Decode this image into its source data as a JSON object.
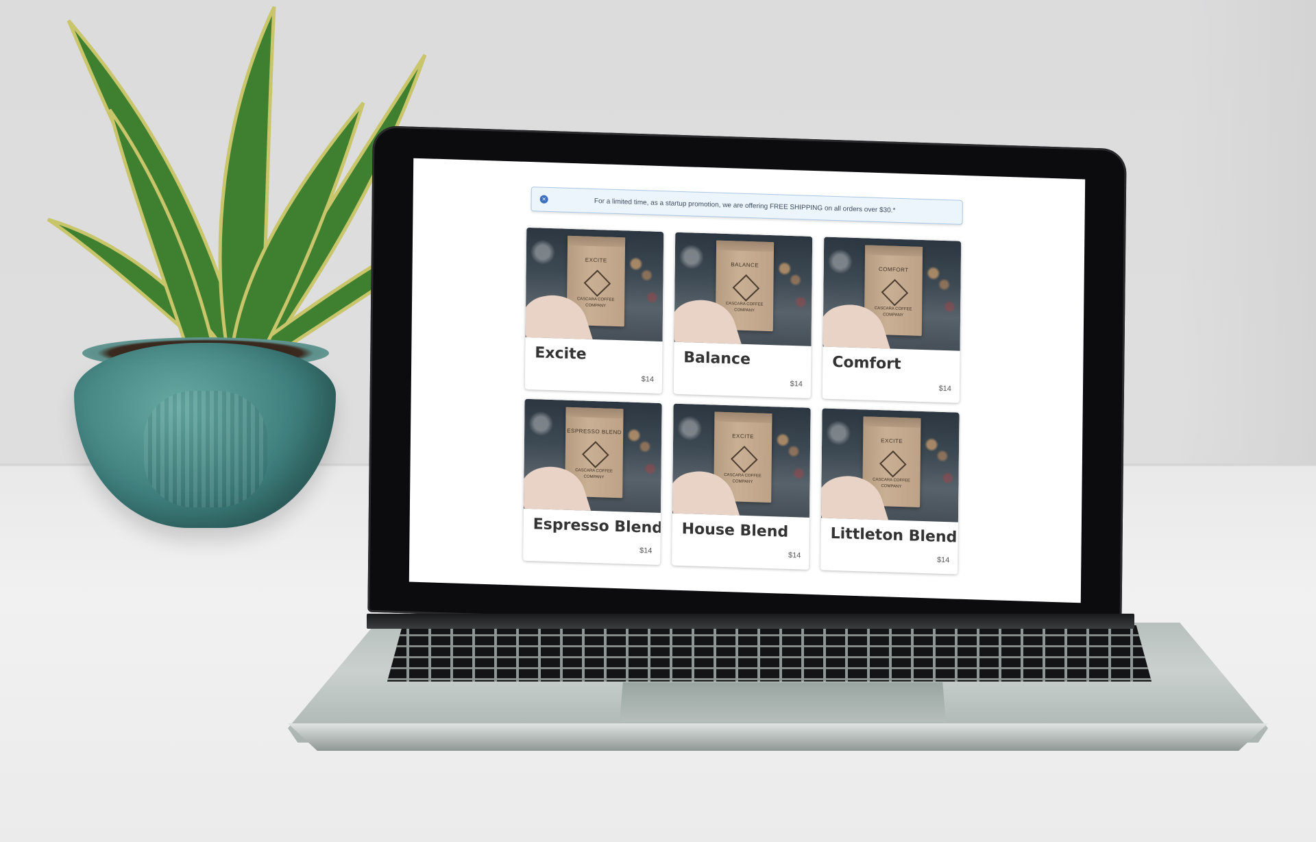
{
  "promo": {
    "close_icon": "×",
    "text": "For a limited time, as a startup promotion, we are offering FREE SHIPPING on all orders over $30.*"
  },
  "bag_company": "CASCARA COFFEE COMPANY",
  "products": [
    {
      "name": "Excite",
      "bag_label": "EXCITE",
      "price": "$14"
    },
    {
      "name": "Balance",
      "bag_label": "BALANCE",
      "price": "$14"
    },
    {
      "name": "Comfort",
      "bag_label": "COMFORT",
      "price": "$14"
    },
    {
      "name": "Espresso Blend",
      "bag_label": "ESPRESSO BLEND",
      "price": "$14"
    },
    {
      "name": "House Blend",
      "bag_label": "EXCITE",
      "price": "$14"
    },
    {
      "name": "Littleton Blend",
      "bag_label": "EXCITE",
      "price": "$14"
    }
  ],
  "colors": {
    "promo_bg": "#edf5fc",
    "promo_border": "#a9c7e4",
    "pot": "#3d7d7b"
  }
}
